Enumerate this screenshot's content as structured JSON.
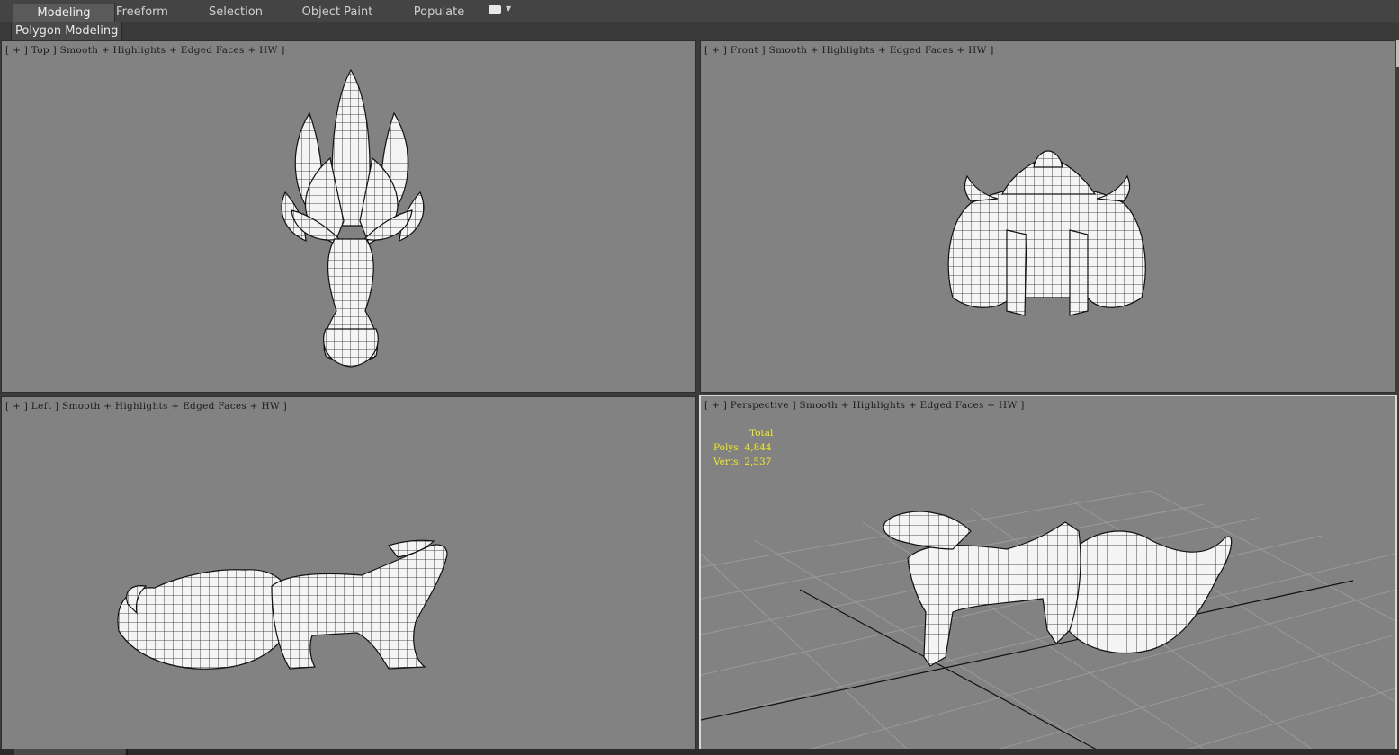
{
  "ribbon": {
    "tabs": [
      {
        "label": "Modeling",
        "active": true
      },
      {
        "label": "Freeform",
        "active": false
      },
      {
        "label": "Selection",
        "active": false
      },
      {
        "label": "Object Paint",
        "active": false
      },
      {
        "label": "Populate",
        "active": false
      }
    ],
    "panel_label": "Polygon Modeling"
  },
  "viewports": {
    "top": {
      "label": "[ + ] Top ] Smooth + Highlights + Edged Faces + HW ]"
    },
    "front": {
      "label": "[ + ] Front ] Smooth + Highlights + Edged Faces + HW ]"
    },
    "left": {
      "label": "[ + ] Left ] Smooth + Highlights + Edged Faces + HW ]"
    },
    "perspective": {
      "label": "[ + ] Perspective ] Smooth + Highlights + Edged Faces + HW ]",
      "stats": {
        "title": "Total",
        "polys": "Polys: 4,844",
        "verts": "Verts: 2,537"
      }
    }
  },
  "colors": {
    "viewport_bg": "#828282",
    "stats_text": "#f3e826",
    "ui_dark": "#444444"
  }
}
